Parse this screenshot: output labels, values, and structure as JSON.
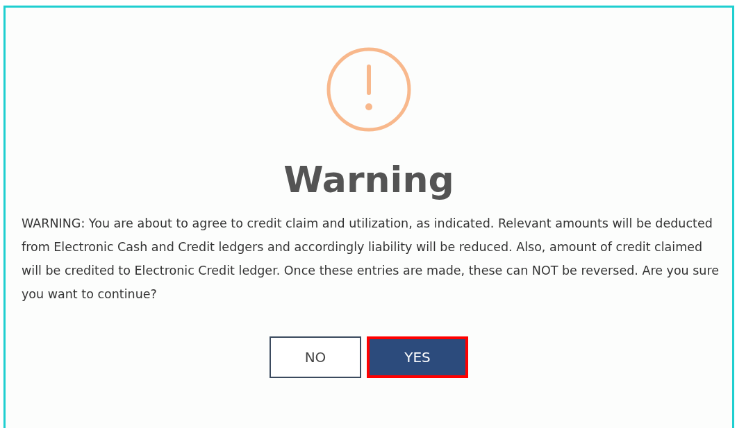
{
  "dialog": {
    "title": "Warning",
    "message": "WARNING: You are about to agree to credit claim and utilization, as indicated. Relevant amounts will be deducted from Electronic Cash and Credit ledgers and accordingly liability will be reduced. Also, amount of credit claimed will be credited to Electronic Credit ledger. Once these entries are made, these can NOT be reversed. Are you sure you want to continue?",
    "buttons": [
      {
        "label": "NO",
        "kind": "secondary",
        "highlighted": false
      },
      {
        "label": "YES",
        "kind": "primary",
        "highlighted": true
      }
    ]
  }
}
